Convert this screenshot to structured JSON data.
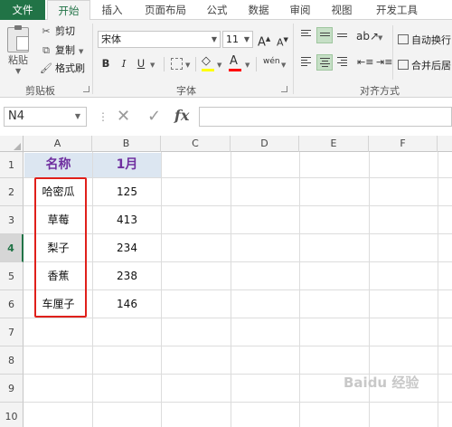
{
  "ribbon": {
    "tabs": [
      "文件",
      "开始",
      "插入",
      "页面布局",
      "公式",
      "数据",
      "审阅",
      "视图",
      "开发工具"
    ],
    "clipboard": {
      "paste_label": "粘贴",
      "cut_label": "剪切",
      "copy_label": "复制",
      "format_painter_label": "格式刷",
      "group_label": "剪贴板"
    },
    "font": {
      "font_name": "宋体",
      "font_size": "11",
      "grow_label": "A",
      "shrink_label": "A",
      "bold": "B",
      "italic": "I",
      "underline": "U",
      "font_color_label": "A",
      "phonetic_label": "wén",
      "group_label": "字体",
      "highlight_color": "#ffff00",
      "font_color": "#ff0000"
    },
    "alignment": {
      "wrap_text_label": "自动换行",
      "merge_center_label": "合并后居",
      "group_label": "对齐方式"
    }
  },
  "formula_bar": {
    "name_box": "N4",
    "fx_label": "fx",
    "formula": ""
  },
  "sheet": {
    "columns": [
      "A",
      "B",
      "C",
      "D",
      "E",
      "F"
    ],
    "rows": [
      "1",
      "2",
      "3",
      "4",
      "5",
      "6",
      "7",
      "8",
      "9",
      "10"
    ],
    "selected_row": "4",
    "headers": {
      "name": "名称",
      "month": "1月"
    },
    "data": [
      {
        "name": "哈密瓜",
        "value": "125"
      },
      {
        "name": "草莓",
        "value": "413"
      },
      {
        "name": "梨子",
        "value": "234"
      },
      {
        "name": "香蕉",
        "value": "238"
      },
      {
        "name": "车厘子",
        "value": "146"
      }
    ]
  },
  "watermark": "Baidu 经验",
  "colors": {
    "accent": "#217346",
    "highlight_box": "#e0201b",
    "header_fill": "#dce6f1",
    "header_text": "#7030a0"
  }
}
